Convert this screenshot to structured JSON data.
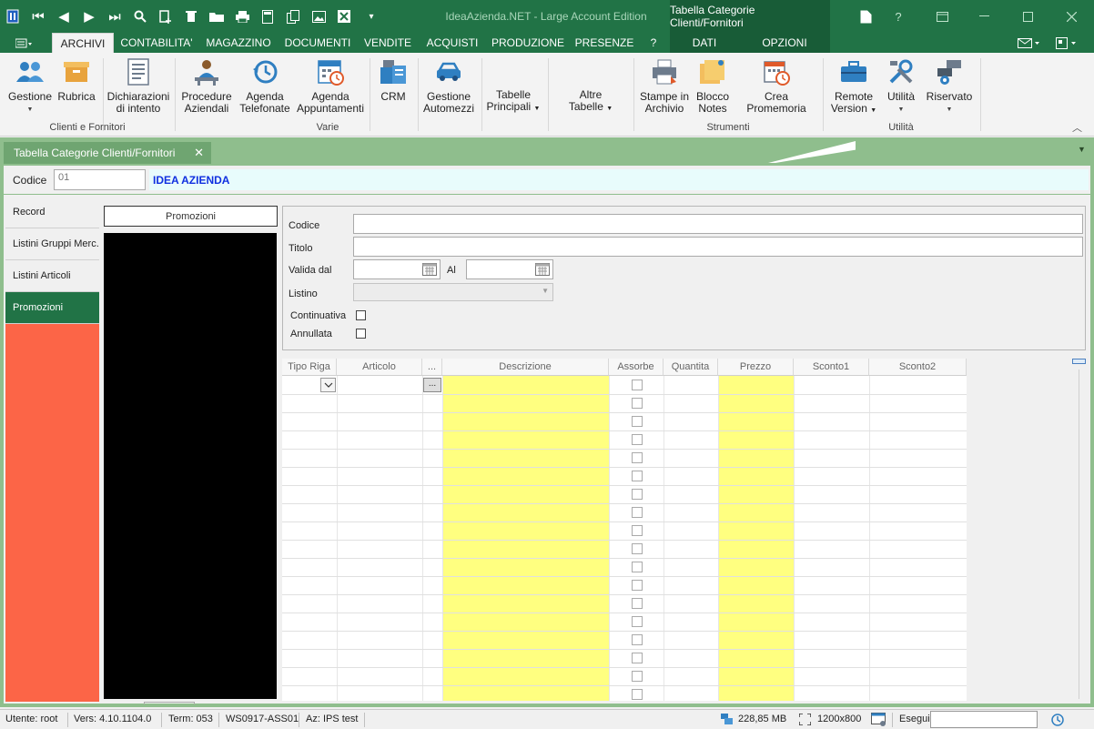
{
  "titlebar": {
    "app_title": "IdeaAzienda.NET - Large Account Edition",
    "context_group": "Tabella Categorie Clienti/Fornitori",
    "help": "?"
  },
  "tabs": [
    "ARCHIVI",
    "CONTABILITA'",
    "MAGAZZINO",
    "DOCUMENTI",
    "VENDITE",
    "ACQUISTI",
    "PRODUZIONE",
    "PRESENZE",
    "?"
  ],
  "context_tabs": [
    "DATI",
    "OPZIONI"
  ],
  "ribbon": {
    "gestione": "Gestione",
    "rubrica": "Rubrica",
    "dichiarazioni_1": "Dichiarazioni",
    "dichiarazioni_2": "di intento",
    "procedure_1": "Procedure",
    "procedure_2": "Aziendali",
    "agenda_tel_1": "Agenda",
    "agenda_tel_2": "Telefonate",
    "agenda_app_1": "Agenda",
    "agenda_app_2": "Appuntamenti",
    "crm": "CRM",
    "automezzi_1": "Gestione",
    "automezzi_2": "Automezzi",
    "tabelle_1": "Tabelle",
    "tabelle_2": "Principali",
    "altre_1": "Altre",
    "altre_2": "Tabelle",
    "stampe_1": "Stampe in",
    "stampe_2": "Archivio",
    "blocco_1": "Blocco",
    "blocco_2": "Notes",
    "promemoria": "Crea Promemoria",
    "remote_1": "Remote",
    "remote_2": "Version",
    "utilita": "Utilità",
    "riservato": "Riservato",
    "groups": {
      "clienti": "Clienti e Fornitori",
      "varie": "Varie",
      "strumenti": "Strumenti",
      "utilita": "Utilità"
    }
  },
  "document": {
    "tab_title": "Tabella Categorie Clienti/Fornitori",
    "codice_label": "Codice",
    "codice_value": "01",
    "azienda": "IDEA AZIENDA"
  },
  "nav": [
    "Record",
    "Listini Gruppi Merc.",
    "Listini Articoli",
    "Promozioni"
  ],
  "promo_header": "Promozioni",
  "form": {
    "codice": "Codice",
    "titolo": "Titolo",
    "valida_dal": "Valida dal",
    "al": "Al",
    "listino": "Listino",
    "continuativa": "Continuativa",
    "annullata": "Annullata"
  },
  "grid": {
    "columns": [
      "Tipo Riga",
      "Articolo",
      "...",
      "Descrizione",
      "Assorbe",
      "Quantita",
      "Prezzo",
      "Sconto1",
      "Sconto2"
    ],
    "ellipsis_button": "..."
  },
  "status": {
    "utente": "Utente: root",
    "versione": "Vers: 4.10.1104.0",
    "term": "Term: 053",
    "workstation": "WS0917-ASS01",
    "az": "Az: IPS test",
    "memory": "228,85 MB",
    "resolution": "1200x800",
    "esegui": "Esegui"
  },
  "colors": {
    "brand_green": "#217346",
    "doc_area": "#8fbe8d",
    "nav_orange": "#fc6547",
    "grid_yellow": "#ffff80",
    "azienda_blue": "#1030e0"
  }
}
